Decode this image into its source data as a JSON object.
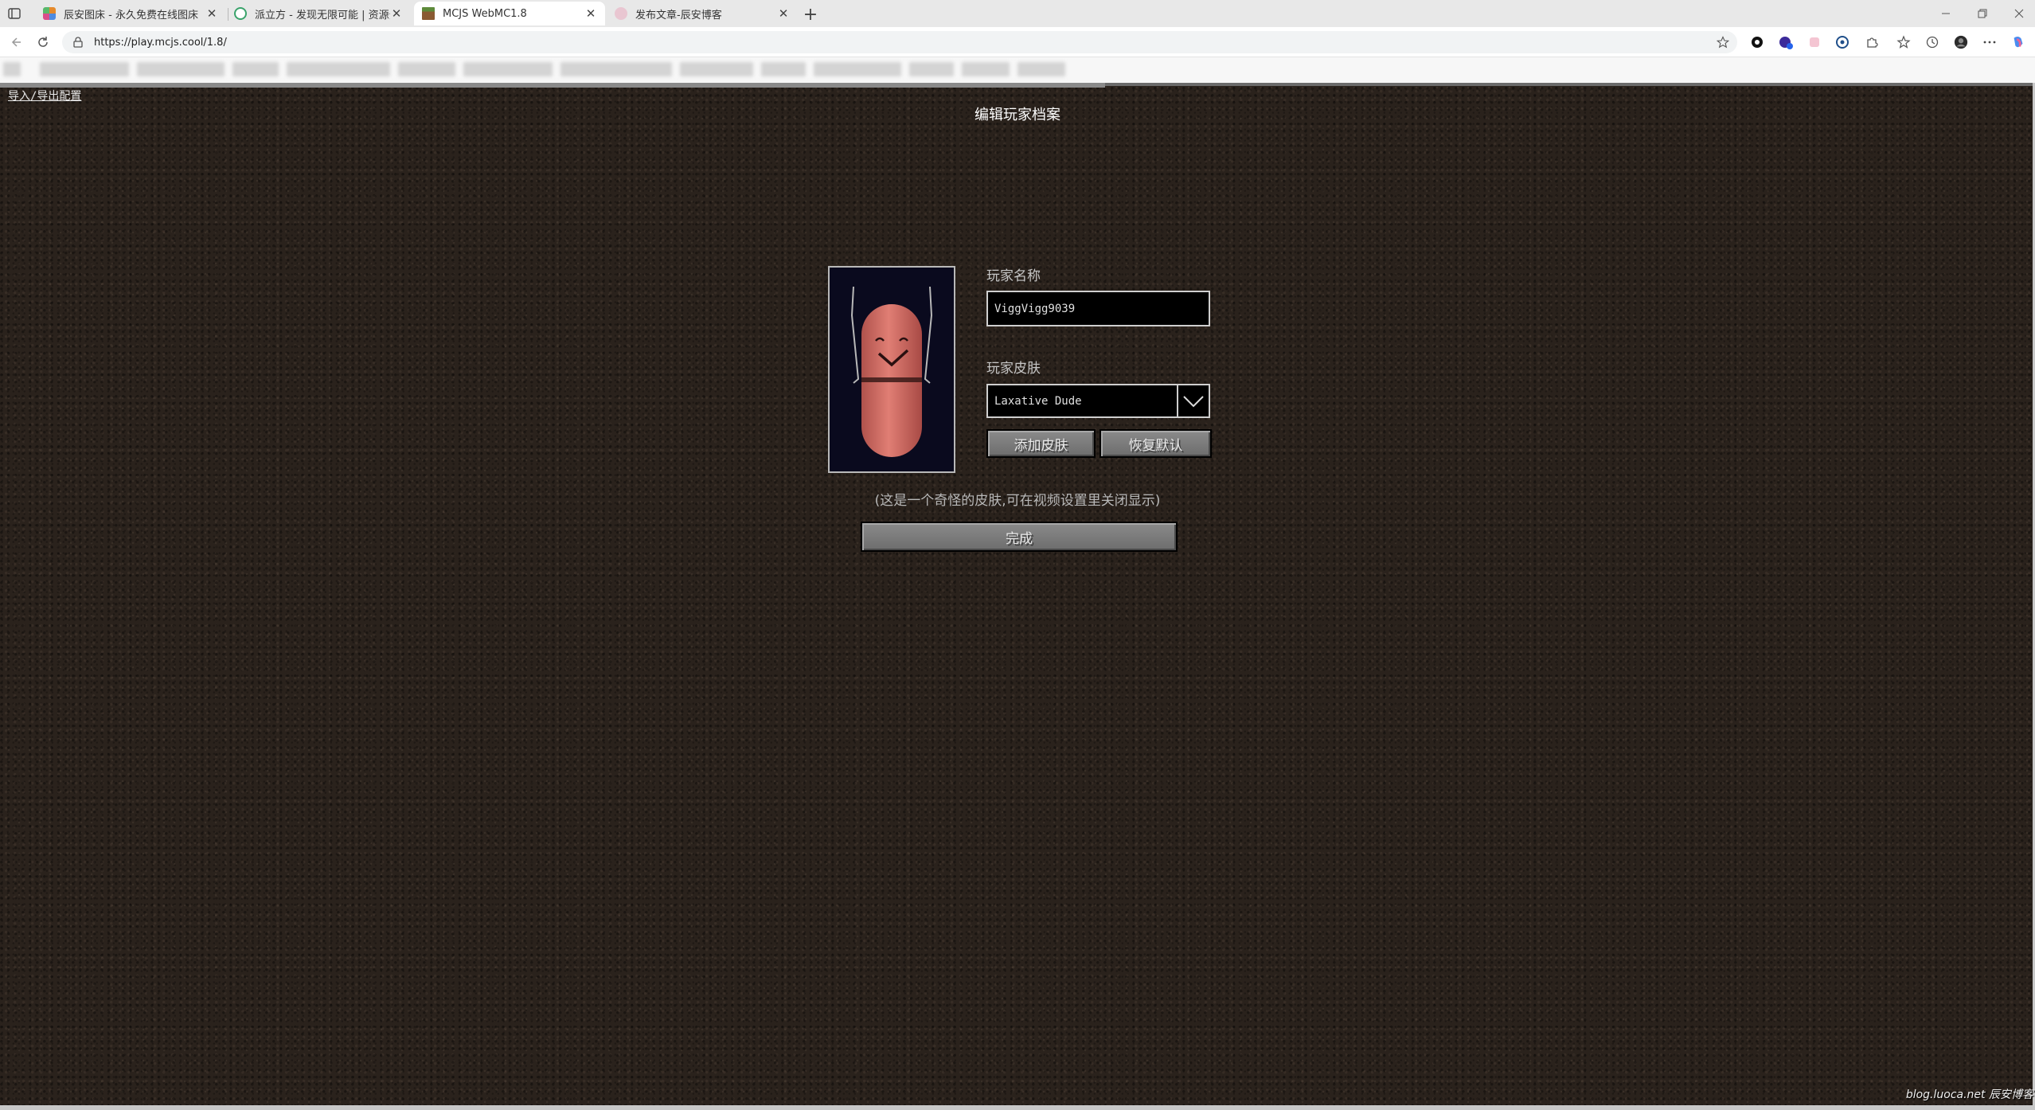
{
  "browser": {
    "tabs": [
      {
        "title": "辰安图床 - 永久免费在线图床",
        "favicon_color": "#e58a2b",
        "active": false
      },
      {
        "title": "派立方 - 发现无限可能 | 资源分享",
        "favicon_color": "#3aa36b",
        "active": false
      },
      {
        "title": "MCJS WebMC1.8",
        "favicon_color": "#5d8a3a",
        "active": true
      },
      {
        "title": "发布文章-辰安博客",
        "favicon_color": "#d9a8b8",
        "active": false
      }
    ],
    "tab_close_glyph": "✕",
    "new_tab_glyph": "+",
    "url": "https://play.mcjs.cool/1.8/"
  },
  "game": {
    "import_export_link": "导入/导出配置",
    "screen_title": "编辑玩家档案",
    "player_name_label": "玩家名称",
    "player_name_value": "ViggVigg9039",
    "player_skin_label": "玩家皮肤",
    "player_skin_selected": "Laxative Dude",
    "add_skin_button": "添加皮肤",
    "restore_default_button": "恢复默认",
    "skin_hint": "(这是一个奇怪的皮肤,可在视频设置里关闭显示)",
    "done_button": "完成"
  },
  "watermark": "blog.luoca.net 辰安博客",
  "colors": {
    "game_background": "#2a221c",
    "pill_body": "#d87068",
    "preview_background": "#0a0a1e"
  }
}
